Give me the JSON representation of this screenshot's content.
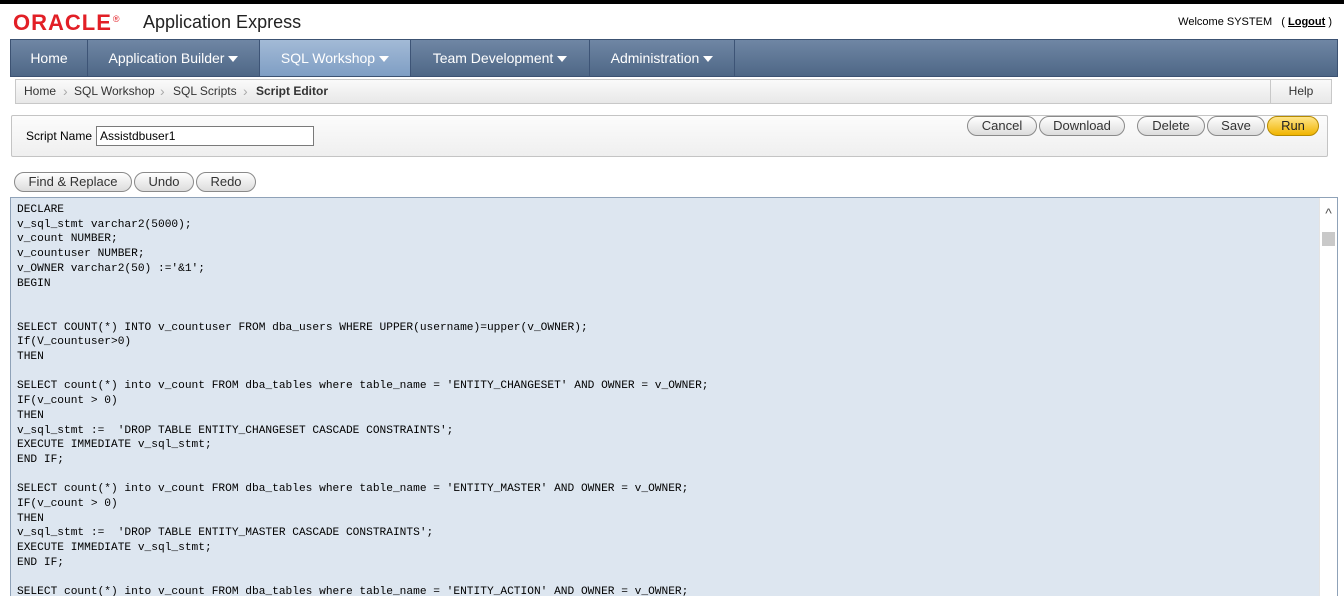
{
  "header": {
    "logo_text": "ORACLE",
    "app_title": "Application Express",
    "welcome_text": "Welcome SYSTEM",
    "logout_label": "Logout"
  },
  "tabs": [
    {
      "label": "Home",
      "has_menu": false
    },
    {
      "label": "Application Builder",
      "has_menu": true
    },
    {
      "label": "SQL Workshop",
      "has_menu": true,
      "active": true
    },
    {
      "label": "Team Development",
      "has_menu": true
    },
    {
      "label": "Administration",
      "has_menu": true
    }
  ],
  "breadcrumb": {
    "items": [
      "Home",
      "SQL Workshop",
      "SQL Scripts",
      "Script Editor"
    ],
    "help_label": "Help"
  },
  "script_panel": {
    "name_label": "Script Name",
    "name_value": "Assistdbuser1",
    "buttons": {
      "cancel": "Cancel",
      "download": "Download",
      "delete": "Delete",
      "save": "Save",
      "run": "Run"
    }
  },
  "editor_toolbar": {
    "find_replace": "Find & Replace",
    "undo": "Undo",
    "redo": "Redo"
  },
  "editor": {
    "code": "DECLARE\nv_sql_stmt varchar2(5000);\nv_count NUMBER;\nv_countuser NUMBER;\nv_OWNER varchar2(50) :='&1';\nBEGIN\n\n\nSELECT COUNT(*) INTO v_countuser FROM dba_users WHERE UPPER(username)=upper(v_OWNER);\nIf(V_countuser>0)\nTHEN\n\nSELECT count(*) into v_count FROM dba_tables where table_name = 'ENTITY_CHANGESET' AND OWNER = v_OWNER;\nIF(v_count > 0)\nTHEN\nv_sql_stmt :=  'DROP TABLE ENTITY_CHANGESET CASCADE CONSTRAINTS';\nEXECUTE IMMEDIATE v_sql_stmt;\nEND IF;\n\nSELECT count(*) into v_count FROM dba_tables where table_name = 'ENTITY_MASTER' AND OWNER = v_OWNER;\nIF(v_count > 0)\nTHEN\nv_sql_stmt :=  'DROP TABLE ENTITY_MASTER CASCADE CONSTRAINTS';\nEXECUTE IMMEDIATE v_sql_stmt;\nEND IF;\n\nSELECT count(*) into v_count FROM dba_tables where table_name = 'ENTITY_ACTION' AND OWNER = v_OWNER;"
  },
  "colors": {
    "oracle_red": "#e21f26",
    "tabbar": "#5a7292",
    "editor_bg": "#dde6f0",
    "run_button": "#f5c316"
  }
}
